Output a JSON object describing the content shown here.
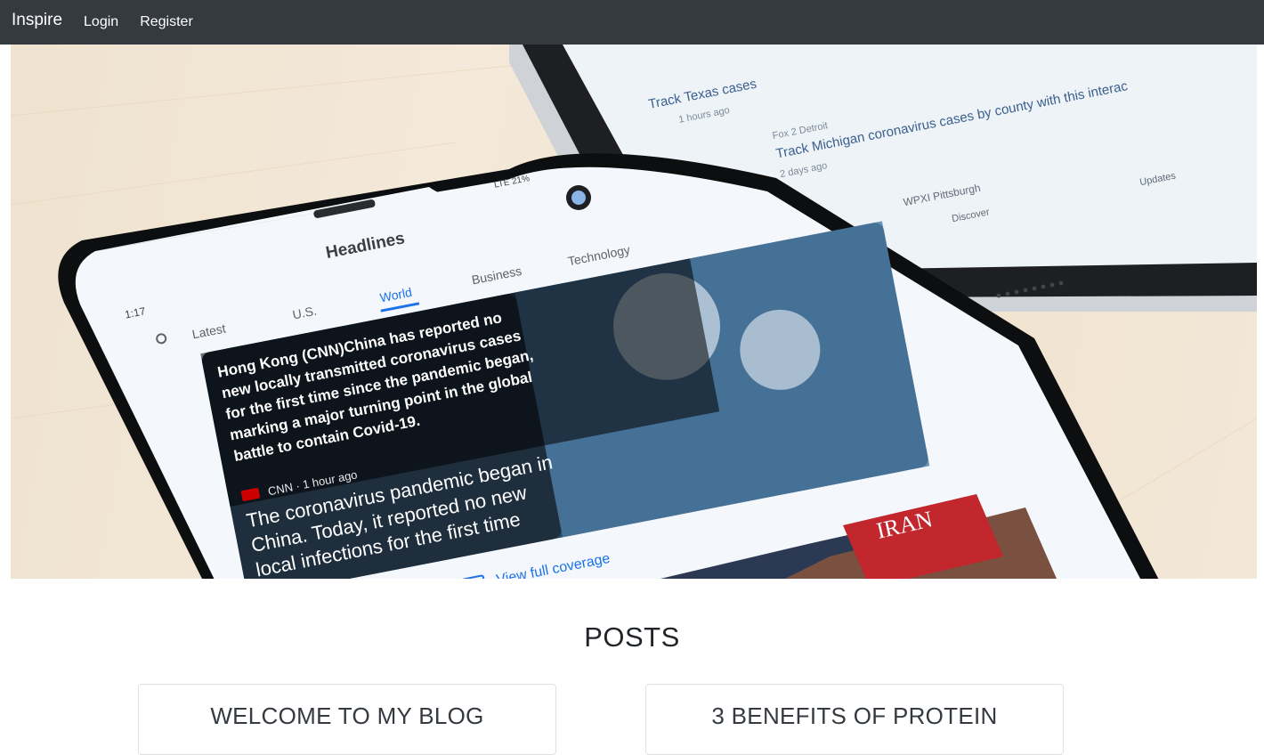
{
  "navbar": {
    "brand": "Inspire",
    "links": [
      "Login",
      "Register"
    ]
  },
  "hero": {
    "phone": {
      "time": "1:17",
      "status": "LTE 21%",
      "app_title": "Headlines",
      "tabs": [
        "Latest",
        "U.S.",
        "World",
        "Business",
        "Technology"
      ],
      "active_tab": "World",
      "summary": [
        "Hong Kong (CNN)China has reported no",
        "new locally transmitted coronavirus cases",
        "for the first time since the pandemic began,",
        "marking a major turning point in the global",
        "battle to contain Covid-19."
      ],
      "source": "CNN · 1 hour ago",
      "headline": [
        "The coronavirus pandemic began in",
        "China. Today, it reported no new",
        "local infections for the first time"
      ],
      "full_coverage": "View full coverage",
      "second_story": "IRAN"
    },
    "tablet": {
      "lines": [
        "Track Texas cases",
        "1 hours ago",
        "Fox 2 Detroit",
        "Track Michigan coronavirus cases by county with this interac",
        "2 days ago",
        "WPXI Pittsburgh"
      ],
      "nav": [
        "Discover",
        "Updates"
      ]
    }
  },
  "posts": {
    "heading": "POSTS",
    "cards": [
      {
        "title": "WELCOME TO MY BLOG"
      },
      {
        "title": "3 BENEFITS OF PROTEIN"
      }
    ]
  },
  "colors": {
    "navbar_bg": "#343a40",
    "link_blue": "#1a73e8"
  }
}
